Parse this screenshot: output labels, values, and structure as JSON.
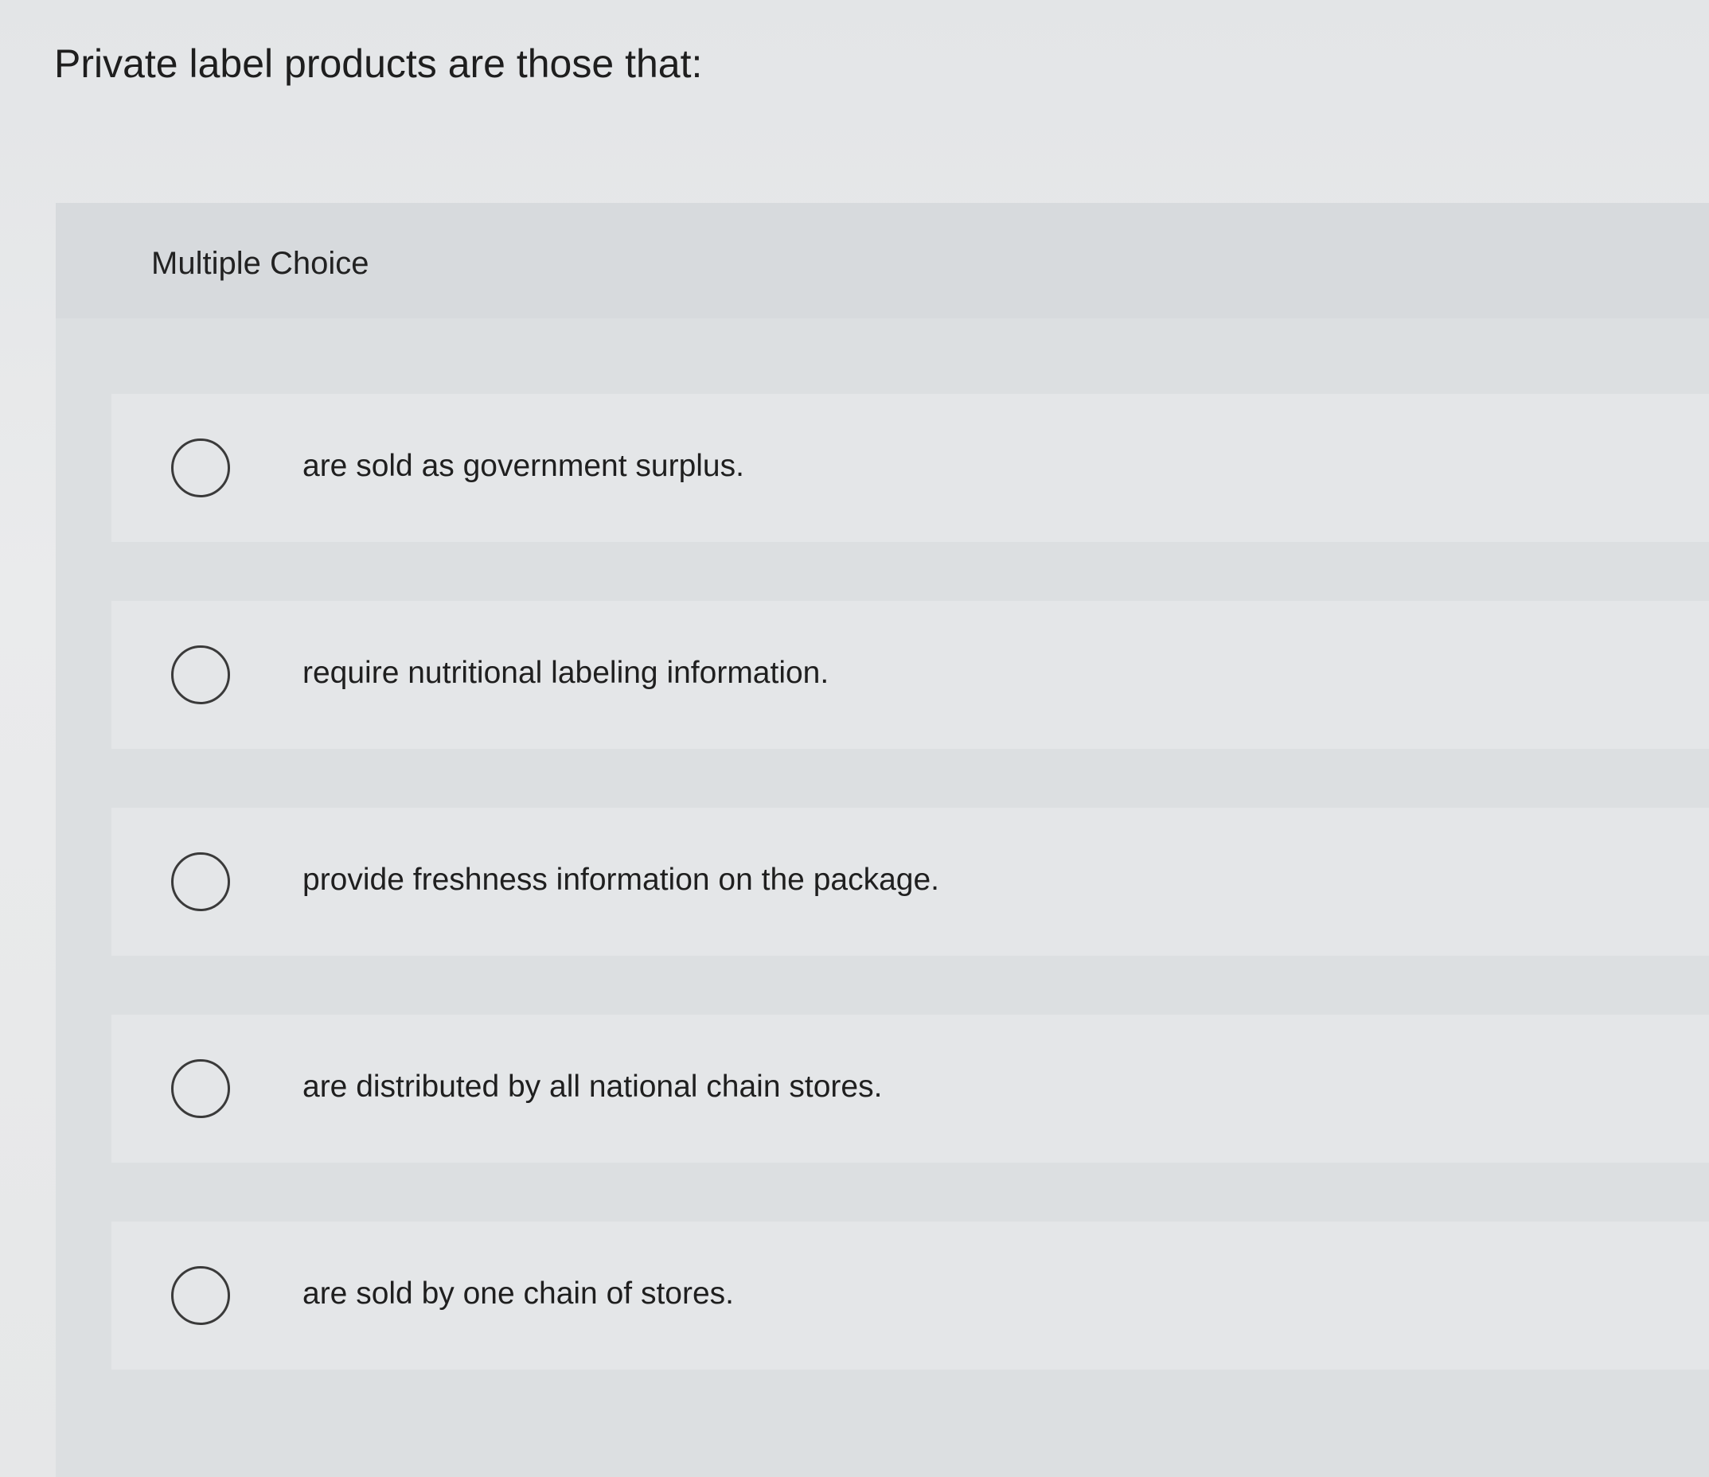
{
  "question": {
    "text": "Private label products are those that:"
  },
  "panel": {
    "title": "Multiple Choice"
  },
  "choices": [
    {
      "label": "are sold as government surplus.",
      "selected": false
    },
    {
      "label": "require nutritional labeling information.",
      "selected": false
    },
    {
      "label": "provide freshness information on the package.",
      "selected": false
    },
    {
      "label": "are distributed by all national chain stores.",
      "selected": false
    },
    {
      "label": "are sold by one chain of stores.",
      "selected": false
    }
  ]
}
